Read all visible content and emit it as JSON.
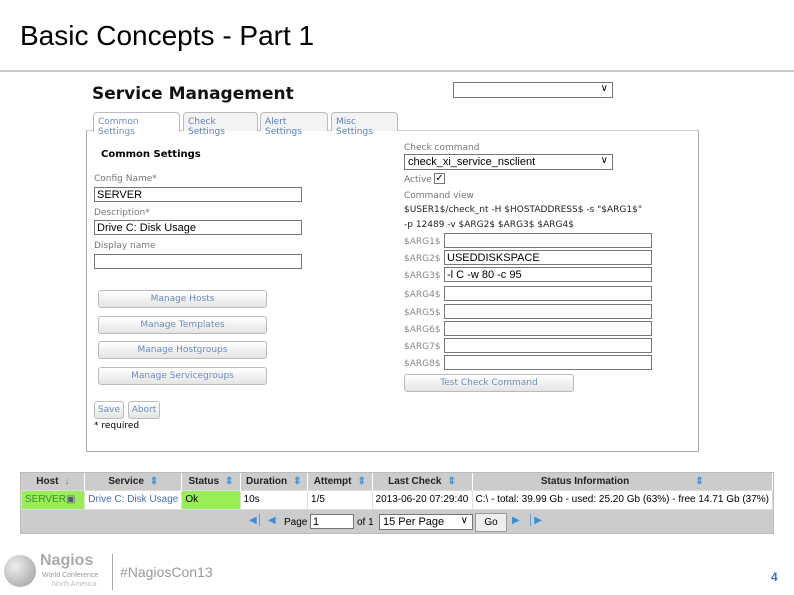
{
  "slide": {
    "title": "Basic Concepts - Part 1",
    "page_number": "4",
    "hashtag": "#NagiosCon13",
    "logo": {
      "name": "Nagios",
      "line1": "World Conference",
      "line2": "North America"
    }
  },
  "form": {
    "title": "Service Management",
    "tabs": [
      {
        "label": "Common Settings",
        "active": true
      },
      {
        "label": "Check Settings"
      },
      {
        "label": "Alert Settings"
      },
      {
        "label": "Misc Settings"
      }
    ],
    "section_title": "Common Settings",
    "config_name_label": "Config Name*",
    "config_name": "SERVER",
    "description_label": "Description*",
    "description": "Drive C: Disk Usage",
    "display_name_label": "Display name",
    "display_name": "",
    "buttons": [
      "Manage Hosts",
      "Manage Templates",
      "Manage Hostgroups",
      "Manage Servicegroups"
    ],
    "save": "Save",
    "abort": "Abort",
    "required_note": "* required",
    "check_command_label": "Check command",
    "check_command": "check_xi_service_nsclient",
    "active_label": "Active",
    "active": true,
    "command_view_label": "Command view",
    "command_view_line1": "$USER1$/check_nt -H $HOSTADDRESS$ -s \"$ARG1$\"",
    "command_view_line2": "-p 12489 -v $ARG2$ $ARG3$ $ARG4$",
    "args": [
      {
        "label": "$ARG1$",
        "value": ""
      },
      {
        "label": "$ARG2$",
        "value": "USEDDISKSPACE"
      },
      {
        "label": "$ARG3$",
        "value": "-l C -w 80 -c 95"
      },
      {
        "label": "$ARG4$",
        "value": ""
      },
      {
        "label": "$ARG5$",
        "value": ""
      },
      {
        "label": "$ARG6$",
        "value": ""
      },
      {
        "label": "$ARG7$",
        "value": ""
      },
      {
        "label": "$ARG8$",
        "value": ""
      }
    ],
    "test_button": "Test Check Command"
  },
  "grid": {
    "headers": [
      "Host",
      "Service",
      "Status",
      "Duration",
      "Attempt",
      "Last Check",
      "Status Information"
    ],
    "row": {
      "host": "SERVER",
      "service": "Drive C: Disk Usage",
      "status": "Ok",
      "duration": "10s",
      "attempt": "1/5",
      "last_check": "2013-06-20 07:29:40",
      "info": "C:\\ - total: 39.99 Gb - used: 25.20 Gb (63%) - free 14.71 Gb (37%)"
    },
    "status_color": "#99ee55",
    "pager": {
      "page_label": "Page",
      "page": "1",
      "of": "of 1",
      "per_page": "15 Per Page",
      "go": "Go"
    }
  }
}
